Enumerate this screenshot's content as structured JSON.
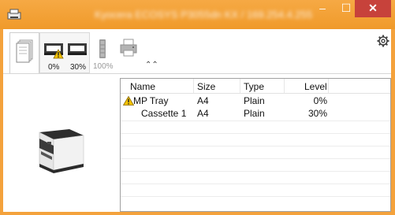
{
  "window": {
    "title": "Kyocera ECOSYS P3055dn KX / 169.254.4.255",
    "controls": {
      "minimize": "–",
      "maximize": "☐",
      "close": "✕"
    }
  },
  "toolbar": {
    "tabs": [
      {
        "name": "paper",
        "icon": "paper-stack-icon"
      },
      {
        "name": "trays",
        "icon": "tray-icon",
        "levels": [
          "0%",
          "30%"
        ],
        "warning_on_first": true
      },
      {
        "name": "toner",
        "icon": "toner-icon",
        "level": "100%"
      },
      {
        "name": "device",
        "icon": "printer-device-icon"
      }
    ],
    "collapse_icon": "double-chevron-up-icon",
    "settings_icon": "gear-icon"
  },
  "table": {
    "columns": [
      "Name",
      "Size",
      "Type",
      "Level"
    ],
    "rows": [
      {
        "name": "MP Tray",
        "size": "A4",
        "type": "Plain",
        "level": "0%",
        "warning": true
      },
      {
        "name": "Cassette 1",
        "size": "A4",
        "type": "Plain",
        "level": "30%",
        "warning": false
      }
    ]
  },
  "colors": {
    "titlebar": "#f09a2a",
    "close": "#c7423b",
    "warning": "#f2c200"
  }
}
